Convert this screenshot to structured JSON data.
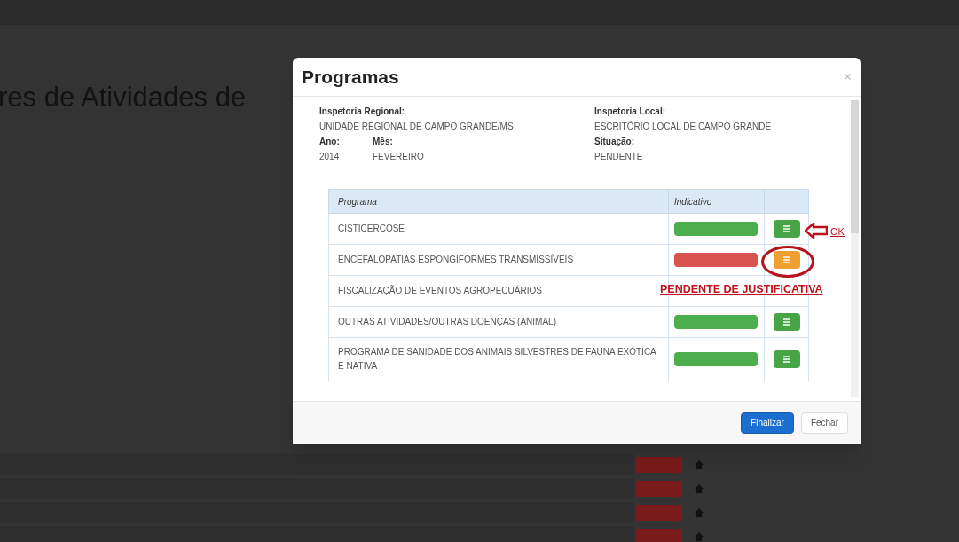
{
  "background_page": {
    "heading": "res de Atividades de",
    "rows_below_dialog": [
      {
        "color": "#7a1a1a"
      },
      {
        "color": "#7a1a1a"
      },
      {
        "color": "#7a1a1a"
      },
      {
        "color": "#7a1a1a"
      }
    ]
  },
  "dialog": {
    "title": "Programas",
    "close": "×",
    "info": [
      {
        "label": "Inspetoria Regional:",
        "value": "UNIDADE REGIONAL DE CAMPO GRANDE/MS"
      },
      {
        "label": "Inspetoria Local:",
        "value": "ESCRITÓRIO LOCAL DE CAMPO GRANDE"
      },
      {
        "label": "Ano:",
        "value": "2014"
      },
      {
        "label": "Mês:",
        "value": "FEVEREIRO"
      },
      {
        "label": "Situação:",
        "value": "PENDENTE"
      }
    ],
    "table": {
      "columns": [
        "Programa",
        "Indicativo"
      ],
      "rows": [
        {
          "programa": "CISTICERCOSE",
          "color": "#4cae4c",
          "kind": "ok"
        },
        {
          "programa": "ENCEFALOPATIAS ESPONGIFORMES TRANSMISSÍVEIS",
          "color": "#d9534f",
          "kind": "pending"
        },
        {
          "programa": "FISCALIZAÇÃO DE EVENTOS AGROPECUÁRIOS",
          "kind": "hidden"
        },
        {
          "programa": "OUTRAS ATIVIDADES/OUTRAS DOENÇAS (ANIMAL)",
          "color": "#4cae4c",
          "kind": "ok"
        },
        {
          "programa": "PROGRAMA DE SANIDADE DOS ANIMAIS SILVESTRES DE FAUNA EXÓTICA E NATIVA",
          "color": "#4cae4c",
          "kind": "ok"
        }
      ]
    },
    "annotations": {
      "ok_label": "OK",
      "pending_label": "PENDENTE DE JUSTIFICATIVA"
    },
    "buttons": [
      {
        "label": "Finalizar",
        "kind": "primary"
      },
      {
        "label": "Fechar",
        "kind": "default"
      }
    ]
  }
}
